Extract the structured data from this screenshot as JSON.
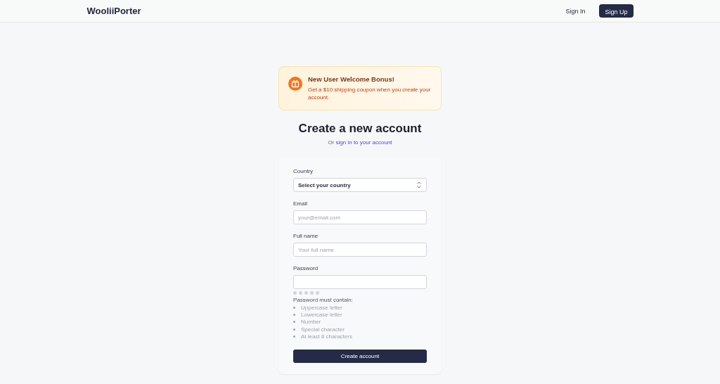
{
  "header": {
    "logo": "WooliiPorter",
    "sign_in": "Sign In",
    "sign_up": "Sign Up"
  },
  "banner": {
    "title": "New User Welcome Bonus!",
    "text": "Get a $10 shipping coupon when you create your account."
  },
  "heading": "Create a new account",
  "subheading": {
    "prefix": "Or",
    "link": "sign in to your account"
  },
  "form": {
    "fields": [
      {
        "kind": "select",
        "label": "Country",
        "value": "Select your country"
      },
      {
        "kind": "text",
        "label": "Email",
        "placeholder": "your@email.com"
      },
      {
        "kind": "text",
        "label": "Full name",
        "placeholder": "Your full name"
      },
      {
        "kind": "password",
        "label": "Password"
      }
    ],
    "requirements_title": "Password must contain:",
    "requirements": [
      {
        "text": "Uppercase letter",
        "met": false
      },
      {
        "text": "Lowercase letter",
        "met": false
      },
      {
        "text": "Number",
        "met": false
      },
      {
        "text": "Special character",
        "met": false
      },
      {
        "text": "At least 8 characters",
        "met": false
      }
    ],
    "submit": "Create account"
  }
}
